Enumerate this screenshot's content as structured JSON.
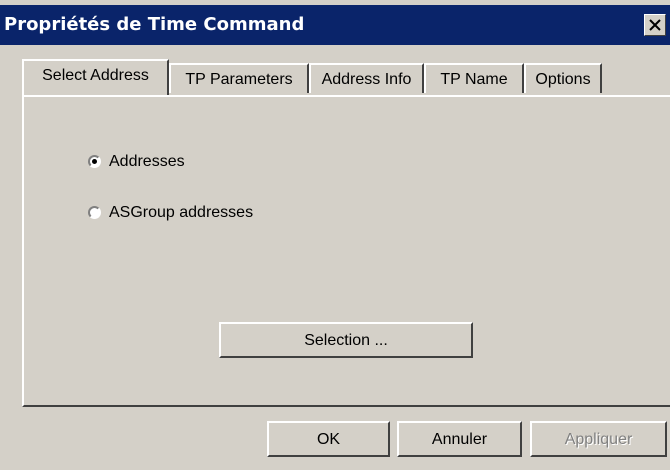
{
  "window": {
    "title": "Propriétés de Time Command",
    "close_icon": "close-icon"
  },
  "tabs": [
    {
      "label": "Select Address",
      "active": true
    },
    {
      "label": "TP Parameters",
      "active": false
    },
    {
      "label": "Address Info",
      "active": false
    },
    {
      "label": "TP Name",
      "active": false
    },
    {
      "label": "Options",
      "active": false
    }
  ],
  "select_address": {
    "options": [
      {
        "label": "Addresses",
        "checked": true
      },
      {
        "label": "ASGroup addresses",
        "checked": false
      }
    ],
    "selection_button": "Selection ..."
  },
  "footer": {
    "ok": "OK",
    "cancel": "Annuler",
    "apply": "Appliquer",
    "apply_enabled": false
  }
}
